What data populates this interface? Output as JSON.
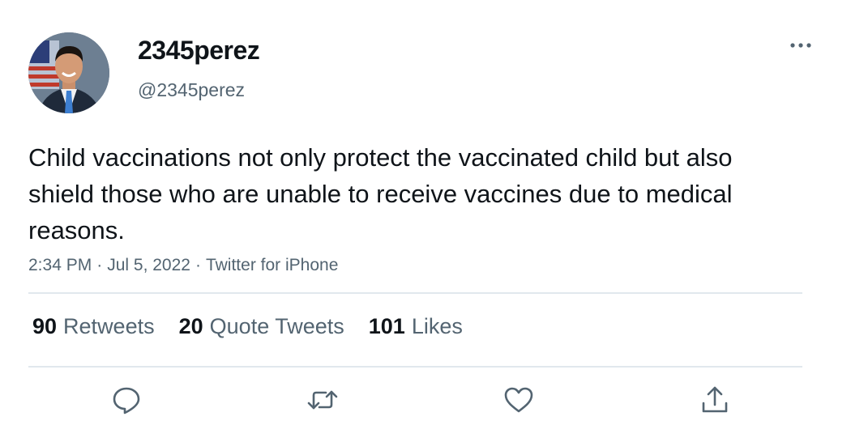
{
  "tweet": {
    "display_name": "2345perez",
    "handle": "@2345perez",
    "text": "Child vaccinations not only protect the vaccinated child but also shield those who are unable to receive vaccines due to medical reasons.",
    "time": "2:34 PM",
    "date": "Jul 5, 2022",
    "source": "Twitter for iPhone",
    "separator": "·"
  },
  "stats": {
    "retweets_count": "90",
    "retweets_label": "Retweets",
    "quotes_count": "20",
    "quotes_label": "Quote Tweets",
    "likes_count": "101",
    "likes_label": "Likes"
  },
  "icons": {
    "more": "more-dots-icon",
    "reply": "reply-icon",
    "retweet": "retweet-icon",
    "like": "heart-icon",
    "share": "share-icon"
  },
  "colors": {
    "text": "#0f1419",
    "secondary": "#536471",
    "divider": "#e1e8ed"
  }
}
